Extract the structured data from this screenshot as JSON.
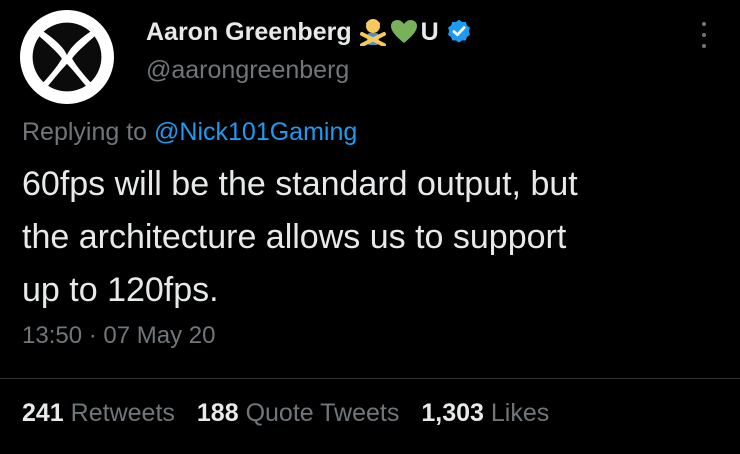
{
  "author": {
    "name": "Aaron Greenberg",
    "suffix_letter": "U",
    "handle": "@aarongreenberg",
    "avatar_icon": "xbox-logo-icon",
    "emoji_icons": [
      "person-gesturing-no-icon",
      "green-heart-icon"
    ],
    "verified_icon": "verified-badge-icon",
    "colors": {
      "verified": "#1d9bf0",
      "heart": "#78b159"
    }
  },
  "reply": {
    "prefix": "Replying to",
    "mention": "@Nick101Gaming"
  },
  "tweet": {
    "lines": [
      "60fps will be the standard output, but",
      "the architecture allows us to support",
      "up to 120fps."
    ]
  },
  "meta": {
    "time": "13:50",
    "separator": "·",
    "date": "07 May 20"
  },
  "stats": {
    "retweets_count": "241",
    "retweets_label": "Retweets",
    "quotes_count": "188",
    "quotes_label": "Quote Tweets",
    "likes_count": "1,303",
    "likes_label": "Likes"
  },
  "theme": {
    "background": "#000000",
    "text": "#e7e9ea",
    "secondary": "#71767b",
    "link": "#1d9bf0"
  }
}
